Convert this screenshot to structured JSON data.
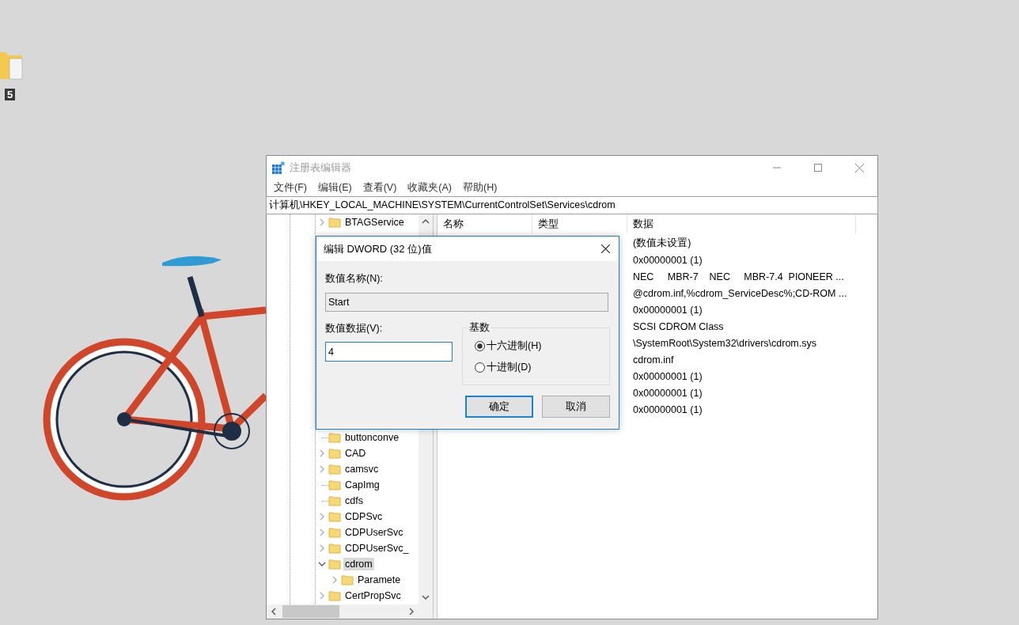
{
  "desktop": {
    "icons": [
      {
        "label": "5"
      }
    ]
  },
  "window": {
    "title": "注册表编辑器"
  },
  "menu": [
    {
      "label": "文件(F)"
    },
    {
      "label": "编辑(E)"
    },
    {
      "label": "查看(V)"
    },
    {
      "label": "收藏夹(A)"
    },
    {
      "label": "帮助(H)"
    }
  ],
  "address": "计算机\\HKEY_LOCAL_MACHINE\\SYSTEM\\CurrentControlSet\\Services\\cdrom",
  "tree": {
    "top_rows": [
      {
        "label": "BTAGService",
        "expandable": true,
        "expanded": false,
        "selected": false
      }
    ],
    "bottom_rows": [
      {
        "label": "buttonconve",
        "expandable": false,
        "selected": false
      },
      {
        "label": "CAD",
        "expandable": true,
        "expanded": false,
        "selected": false
      },
      {
        "label": "camsvc",
        "expandable": true,
        "expanded": false,
        "selected": false
      },
      {
        "label": "CapImg",
        "expandable": false,
        "selected": false
      },
      {
        "label": "cdfs",
        "expandable": false,
        "selected": false
      },
      {
        "label": "CDPSvc",
        "expandable": true,
        "expanded": false,
        "selected": false
      },
      {
        "label": "CDPUserSvc",
        "expandable": true,
        "expanded": false,
        "selected": false
      },
      {
        "label": "CDPUserSvc_",
        "expandable": true,
        "expanded": false,
        "selected": false
      },
      {
        "label": "cdrom",
        "expandable": true,
        "expanded": true,
        "selected": true,
        "children": [
          {
            "label": "Paramete",
            "expandable": true,
            "expanded": false,
            "selected": false
          }
        ]
      },
      {
        "label": "CertPropSvc",
        "expandable": true,
        "expanded": false,
        "selected": false
      }
    ]
  },
  "list": {
    "columns": [
      "名称",
      "类型",
      "数据"
    ],
    "rows": [
      {
        "data": "(数值未设置)"
      },
      {
        "data": "0x00000001 (1)"
      },
      {
        "data": "NEC     MBR-7    NEC     MBR-7.4  PIONEER ..."
      },
      {
        "data": "@cdrom.inf,%cdrom_ServiceDesc%;CD-ROM ..."
      },
      {
        "data": "0x00000001 (1)"
      },
      {
        "data": "SCSI CDROM Class"
      },
      {
        "data": "\\SystemRoot\\System32\\drivers\\cdrom.sys"
      },
      {
        "data": "cdrom.inf"
      },
      {
        "data": "0x00000001 (1)"
      },
      {
        "data": "0x00000001 (1)"
      },
      {
        "data": "0x00000001 (1)"
      }
    ]
  },
  "dialog": {
    "title": "编辑 DWORD (32 位)值",
    "name_label": "数值名称(N):",
    "name_value": "Start",
    "data_label": "数值数据(V):",
    "data_value": "4",
    "base_label": "基数",
    "radios": [
      {
        "label": "十六进制(H)",
        "selected": true
      },
      {
        "label": "十进制(D)",
        "selected": false
      }
    ],
    "buttons": [
      {
        "label": "确定",
        "default": true
      },
      {
        "label": "取消",
        "default": false
      }
    ]
  }
}
